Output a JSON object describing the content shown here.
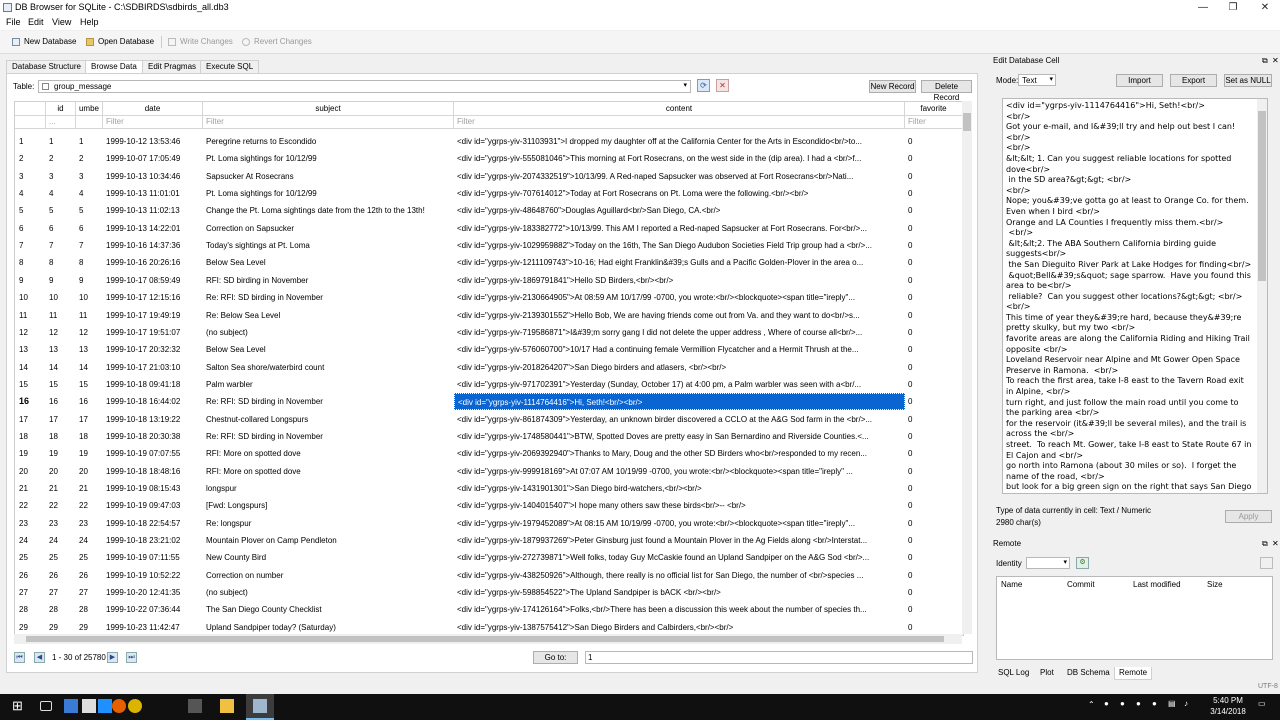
{
  "window": {
    "title": "DB Browser for SQLite - C:\\SDBIRDS\\sdbirds_all.db3",
    "controls": {
      "minimize": "—",
      "restore": "❐",
      "close": "✕"
    }
  },
  "menu": [
    "File",
    "Edit",
    "View",
    "Help"
  ],
  "toolbar": {
    "new_db": "New Database",
    "open_db": "Open Database",
    "write": "Write Changes",
    "revert": "Revert Changes"
  },
  "tabs": [
    "Database Structure",
    "Browse Data",
    "Edit Pragmas",
    "Execute SQL"
  ],
  "browse": {
    "table_label": "Table:",
    "table_value": "group_message",
    "new_record": "New Record",
    "delete_record": "Delete Record",
    "columns": [
      "id",
      "umbe",
      "date",
      "subject",
      "content",
      "favorite"
    ],
    "filters": [
      "...",
      "",
      "Filter",
      "Filter",
      "Filter",
      "Filter"
    ],
    "rows": [
      {
        "n": "1",
        "id": "1",
        "umbe": "1",
        "date": "1999-10-12 13:53:46",
        "subject": "Peregrine returns to Escondido",
        "content": "<div id=\"ygrps-yiv-31103931\">I dropped my daughter off at the California Center for the Arts in Escondido<br/>to...",
        "fav": "0"
      },
      {
        "n": "2",
        "id": "2",
        "umbe": "2",
        "date": "1999-10-07 17:05:49",
        "subject": "Pt. Loma sightings for 10/12/99",
        "content": "<div id=\"ygrps-yiv-555081046\">This morning at Fort Rosecrans, on the west side in the (dip area). I had a <br/>f...",
        "fav": "0"
      },
      {
        "n": "3",
        "id": "3",
        "umbe": "3",
        "date": "1999-10-13 10:34:46",
        "subject": "Sapsucker At Rosecrans",
        "content": "<div id=\"ygrps-yiv-2074332519\">10/13/99. A Red-naped Sapsucker was observed at Fort Rosecrans<br/>Nati...",
        "fav": "0"
      },
      {
        "n": "4",
        "id": "4",
        "umbe": "4",
        "date": "1999-10-13 11:01:01",
        "subject": "Pt. Loma sightings for 10/12/99",
        "content": "<div id=\"ygrps-yiv-707614012\">Today at Fort Rosecrans on Pt. Loma were the following.<br/><br/>",
        "fav": "0"
      },
      {
        "n": "5",
        "id": "5",
        "umbe": "5",
        "date": "1999-10-13 11:02:13",
        "subject": "Change the Pt. Loma sightings date from the 12th to the 13th!",
        "content": "<div id=\"ygrps-yiv-48648760\">Douglas Aguillard<br/>San Diego, CA.<br/>",
        "fav": "0"
      },
      {
        "n": "6",
        "id": "6",
        "umbe": "6",
        "date": "1999-10-13 14:22:01",
        "subject": "Correction on Sapsucker",
        "content": "<div id=\"ygrps-yiv-183382772\">10/13/99. This AM I reported a Red-naped Sapsucker at Fort Rosecrans. For<br/>...",
        "fav": "0"
      },
      {
        "n": "7",
        "id": "7",
        "umbe": "7",
        "date": "1999-10-16 14:37:36",
        "subject": "Today's sightings at Pt. Loma",
        "content": "<div id=\"ygrps-yiv-1029959882\">Today on the 16th, The San Diego Audubon Societies Field Trip group had a <br/>...",
        "fav": "0"
      },
      {
        "n": "8",
        "id": "8",
        "umbe": "8",
        "date": "1999-10-16 20:26:16",
        "subject": "Below Sea Level",
        "content": "<div id=\"ygrps-yiv-1211109743\">10-16;   Had eight Franklin&#39;s Gulls and a Pacific Golden-Plover in the area o...",
        "fav": "0"
      },
      {
        "n": "9",
        "id": "9",
        "umbe": "9",
        "date": "1999-10-17 08:59:49",
        "subject": "RFI:  SD birding in November",
        "content": "<div id=\"ygrps-yiv-1869791841\">Hello SD Birders,<br/><br/>",
        "fav": "0"
      },
      {
        "n": "10",
        "id": "10",
        "umbe": "10",
        "date": "1999-10-17 12:15:16",
        "subject": "Re: RFI:  SD birding in November",
        "content": "<div id=\"ygrps-yiv-2130664905\">At 08:59 AM 10/17/99 -0700, you wrote:<br/><blockquote><span title=\"ireply\"...",
        "fav": "0"
      },
      {
        "n": "11",
        "id": "11",
        "umbe": "11",
        "date": "1999-10-17 19:49:19",
        "subject": "Re: Below Sea Level",
        "content": "<div id=\"ygrps-yiv-2139301552\">Hello Bob,  We are having friends come out from Va.  and they want to do<br/>s...",
        "fav": "0"
      },
      {
        "n": "12",
        "id": "12",
        "umbe": "12",
        "date": "1999-10-17 19:51:07",
        "subject": "(no subject)",
        "content": "<div id=\"ygrps-yiv-719586871\">I&#39;m sorry gang I did not delete the upper address ,  Where of course all<br/>...",
        "fav": "0"
      },
      {
        "n": "13",
        "id": "13",
        "umbe": "13",
        "date": "1999-10-17 20:32:32",
        "subject": "Below Sea Level",
        "content": "<div id=\"ygrps-yiv-576060700\">10/17      Had a continuing female Vermillion Flycatcher and a Hermit Thrush at the...",
        "fav": "0"
      },
      {
        "n": "14",
        "id": "14",
        "umbe": "14",
        "date": "1999-10-17 21:03:10",
        "subject": "Salton Sea shore/waterbird count",
        "content": "<div id=\"ygrps-yiv-2018264207\">San Diego birders and atlasers, <br/><br/>",
        "fav": "0"
      },
      {
        "n": "15",
        "id": "15",
        "umbe": "15",
        "date": "1999-10-18 09:41:18",
        "subject": "Palm warbler",
        "content": "<div id=\"ygrps-yiv-971702391\">Yesterday (Sunday, October 17) at 4:00 pm, a Palm warbler was seen with a<br/...",
        "fav": "0"
      },
      {
        "n": "16",
        "id": "16",
        "umbe": "16",
        "date": "1999-10-18 16:44:02",
        "subject": "Re: RFI:  SD birding in November",
        "content": "<div id=\"ygrps-yiv-1114764416\">Hi, Seth!<br/><br/>",
        "fav": "0"
      },
      {
        "n": "17",
        "id": "17",
        "umbe": "17",
        "date": "1999-10-18 13:19:22",
        "subject": "Chestnut-collared Longspurs",
        "content": "<div id=\"ygrps-yiv-861874309\">Yesterday, an unknown birder discovered a CCLO at the A&G Sod farm in the <br/>...",
        "fav": "0"
      },
      {
        "n": "18",
        "id": "18",
        "umbe": "18",
        "date": "1999-10-18 20:30:38",
        "subject": "Re: RFI:  SD birding in November",
        "content": "<div id=\"ygrps-yiv-1748580441\">BTW, Spotted Doves are pretty easy in San Bernardino and Riverside Counties.<...",
        "fav": "0"
      },
      {
        "n": "19",
        "id": "19",
        "umbe": "19",
        "date": "1999-10-19 07:07:55",
        "subject": "RFI: More on spotted dove",
        "content": "<div id=\"ygrps-yiv-2069392940\">Thanks to Mary, Doug and the other SD Birders who<br/>responded to my recen...",
        "fav": "0"
      },
      {
        "n": "20",
        "id": "20",
        "umbe": "20",
        "date": "1999-10-18 18:48:16",
        "subject": "RFI: More on spotted dove",
        "content": "<div id=\"ygrps-yiv-999918169\">At 07:07 AM 10/19/99 -0700, you wrote:<br/><blockquote><span title=\"ireply\" ...",
        "fav": "0"
      },
      {
        "n": "21",
        "id": "21",
        "umbe": "21",
        "date": "1999-10-19 08:15:43",
        "subject": "longspur",
        "content": "<div id=\"ygrps-yiv-1431901301\">San Diego bird-watchers,<br/><br/>",
        "fav": "0"
      },
      {
        "n": "22",
        "id": "22",
        "umbe": "22",
        "date": "1999-10-19 09:47:03",
        "subject": "[Fwd: Longspurs]",
        "content": "<div id=\"ygrps-yiv-1404015407\">I hope many others saw these birds<br/>-- <br/>",
        "fav": "0"
      },
      {
        "n": "23",
        "id": "23",
        "umbe": "23",
        "date": "1999-10-18 22:54:57",
        "subject": "Re: longspur",
        "content": "<div id=\"ygrps-yiv-1979452089\">At 08:15 AM 10/19/99 -0700, you wrote:<br/><blockquote><span title=\"ireply\"...",
        "fav": "0"
      },
      {
        "n": "24",
        "id": "24",
        "umbe": "24",
        "date": "1999-10-18 23:21:02",
        "subject": "Mountain Plover on Camp Pendleton",
        "content": "<div id=\"ygrps-yiv-1879937269\">Peter Ginsburg just found a Mountain Plover in the Ag Fields along <br/>Interstat...",
        "fav": "0"
      },
      {
        "n": "25",
        "id": "25",
        "umbe": "25",
        "date": "1999-10-19 07:11:55",
        "subject": "New County Bird",
        "content": "<div id=\"ygrps-yiv-272739871\">Well folks, today Guy McCaskie found an Upland Sandpiper on the A&G Sod <br/>...",
        "fav": "0"
      },
      {
        "n": "26",
        "id": "26",
        "umbe": "26",
        "date": "1999-10-19 10:52:22",
        "subject": "Correction on number",
        "content": "<div id=\"ygrps-yiv-438250926\">Although, there really is no official list for San Diego, the number of <br/>species ...",
        "fav": "0"
      },
      {
        "n": "27",
        "id": "27",
        "umbe": "27",
        "date": "1999-10-20 12:41:35",
        "subject": "(no subject)",
        "content": "<div id=\"ygrps-yiv-598854522\">The Upland Sandpiper is  bACK <br/><br/>",
        "fav": "0"
      },
      {
        "n": "28",
        "id": "28",
        "umbe": "28",
        "date": "1999-10-22 07:36:44",
        "subject": "The San Diego County Checklist",
        "content": "<div id=\"ygrps-yiv-174126164\">Folks,<br/>There has been a discussion this week about the number of species th...",
        "fav": "0"
      },
      {
        "n": "29",
        "id": "29",
        "umbe": "29",
        "date": "1999-10-23 11:42:47",
        "subject": "Upland Sandpiper today? (Saturday)",
        "content": "<div id=\"ygrps-yiv-1387575412\">San Diego Birders and Calbirders,<br/><br/>",
        "fav": "0"
      }
    ],
    "selected_row": 16,
    "record_range": "1 - 30 of 25780",
    "goto_label": "Go to:",
    "goto_value": "1"
  },
  "edit_cell": {
    "title": "Edit Database Cell",
    "mode_label": "Mode:",
    "mode_value": "Text",
    "import": "Import",
    "export": "Export",
    "set_null": "Set as NULL",
    "content": "<div id=\"ygrps-yiv-1114764416\">Hi, Seth!<br/>\n<br/>\nGot your e-mail, and I&#39;ll try and help out best I can!<br/>\n<br/>\n&lt;&lt; 1. Can you suggest reliable locations for spotted dove<br/>\n in the SD area?&gt;&gt; <br/>\n<br/>\nNope; you&#39;ve gotta go at least to Orange Co. for them.  Even when I bird <br/>\nOrange and LA Counties I frequently miss them.<br/>\n <br/>\n &lt;&lt;2. The ABA Southern California birding guide suggests<br/>\n the San Dieguito River Park at Lake Hodges for finding<br/>\n &quot;Bell&#39;s&quot; sage sparrow.  Have you found this area to be<br/>\n reliable?  Can you suggest other locations?&gt;&gt; <br/>\n<br/>\nThis time of year they&#39;re hard, because they&#39;re pretty skulky, but my two <br/>\nfavorite areas are along the California Riding and Hiking Trail opposite <br/>\nLoveland Reservoir near Alpine and Mt Gower Open Space Preserve in Ramona.  <br/>\nTo reach the first area, take I-8 east to the Tavern Road exit in Alpine, <br/>\nturn right, and just follow the main road until you come to the parking area <br/>\nfor the reservoir (it&#39;ll be several miles), and the trail is across the <br/>\nstreet.  To reach Mt. Gower, take I-8 east to State Route 67 in El Cajon and <br/>\ngo north into Ramona (about 30 miles or so).  I forget the name of the road, <br/>\nbut look for a big green sign on the right that says San Diego Country <br/>",
    "type_text": "Type of data currently in cell: Text / Numeric",
    "chars_text": "2980 char(s)",
    "apply": "Apply"
  },
  "remote": {
    "title": "Remote",
    "identity_label": "Identity",
    "columns": [
      "Name",
      "Commit",
      "Last modified",
      "Size"
    ]
  },
  "bottom_tabs": [
    "SQL Log",
    "Plot",
    "DB Schema",
    "Remote"
  ],
  "status": {
    "encoding": "UTF-8"
  },
  "taskbar": {
    "time": "5:40 PM",
    "date": "3/14/2018"
  }
}
